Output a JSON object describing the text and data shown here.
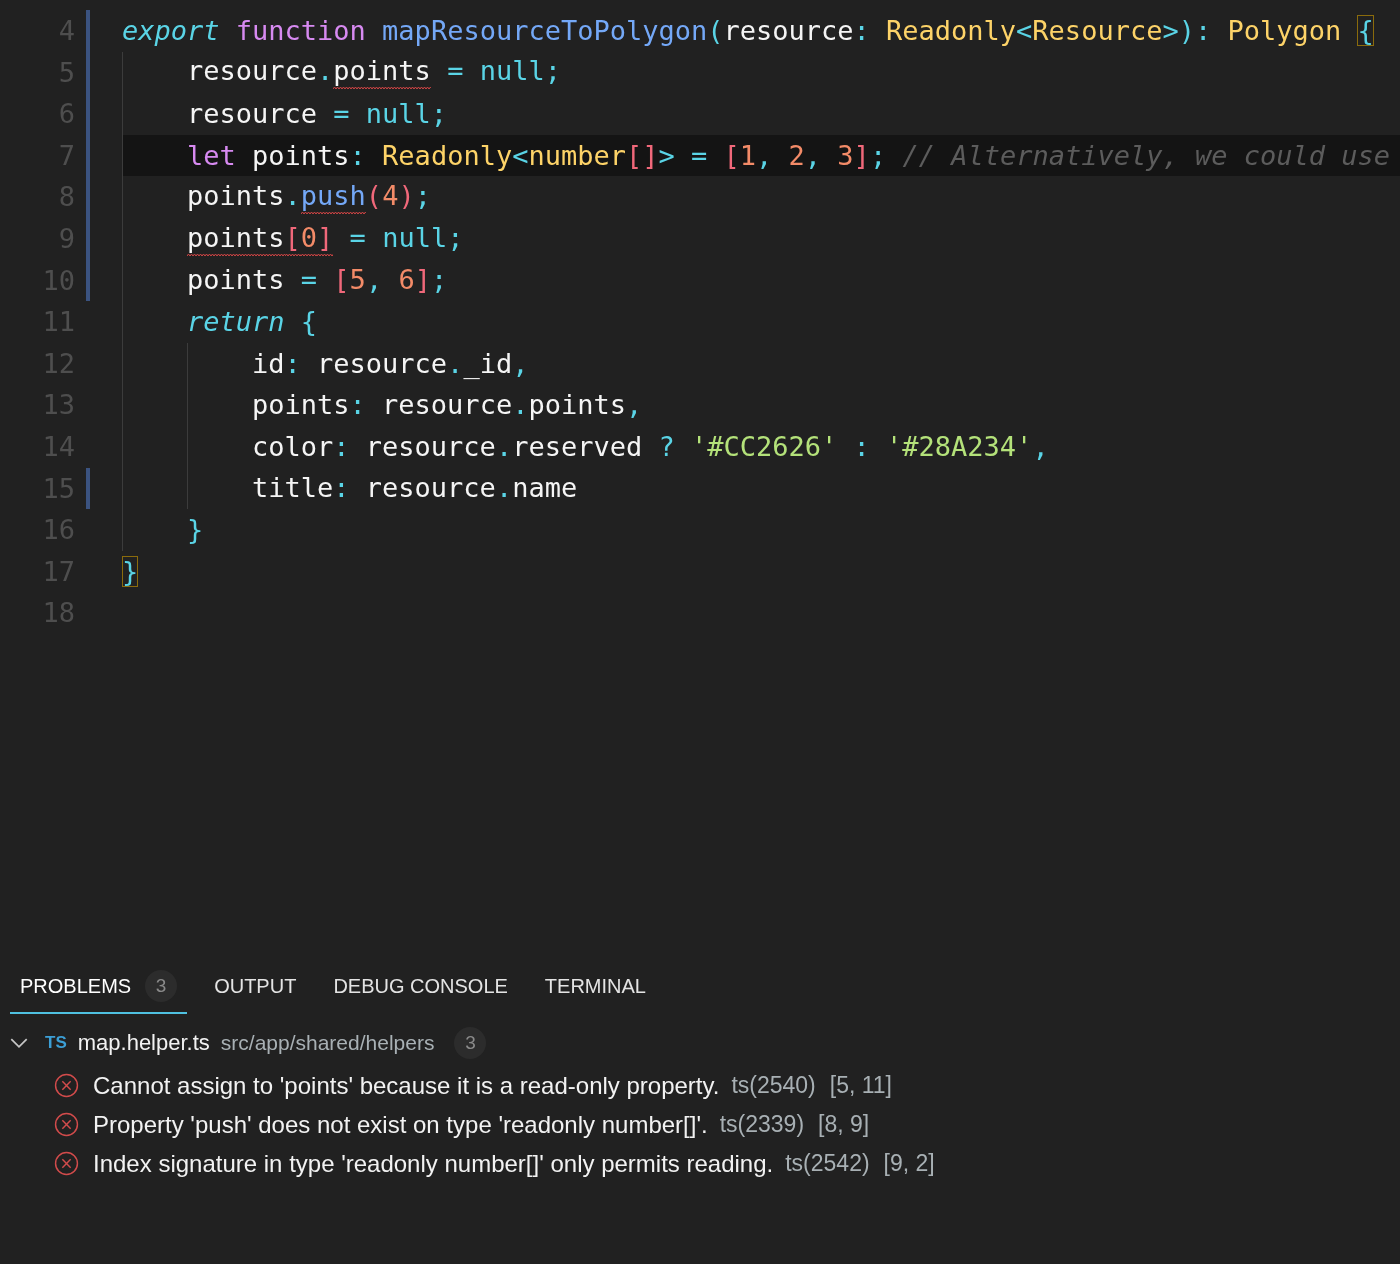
{
  "editor": {
    "lines": [
      {
        "number": "4",
        "modified": true,
        "current": false,
        "tokens": [
          {
            "text": "export ",
            "kind": "keyword"
          },
          {
            "text": "function ",
            "kind": "storage"
          },
          {
            "text": "mapResourceToPolygon",
            "kind": "func"
          },
          {
            "text": "(",
            "kind": "punct"
          },
          {
            "text": "resource",
            "kind": "var"
          },
          {
            "text": ": ",
            "kind": "punct"
          },
          {
            "text": "Readonly",
            "kind": "type"
          },
          {
            "text": "<",
            "kind": "punct"
          },
          {
            "text": "Resource",
            "kind": "type"
          },
          {
            "text": ">): ",
            "kind": "punct"
          },
          {
            "text": "Polygon ",
            "kind": "type"
          },
          {
            "text": "{",
            "kind": "punct",
            "matched": true
          }
        ],
        "children": [
          {
            "number": "5",
            "modified": true,
            "current": false,
            "tokens": [
              {
                "text": "resource",
                "kind": "var"
              },
              {
                "text": ".",
                "kind": "punct"
              },
              {
                "text": "points",
                "kind": "var",
                "error": true
              },
              {
                "text": " = null;",
                "kind": "punct"
              }
            ]
          },
          {
            "number": "6",
            "modified": true,
            "current": false,
            "tokens": [
              {
                "text": "resource",
                "kind": "var"
              },
              {
                "text": " = null;",
                "kind": "punct"
              }
            ]
          },
          {
            "number": "7",
            "modified": true,
            "current": true,
            "tokens": [
              {
                "text": "let ",
                "kind": "storage"
              },
              {
                "text": "points",
                "kind": "var"
              },
              {
                "text": ": ",
                "kind": "punct"
              },
              {
                "text": "Readonly",
                "kind": "type"
              },
              {
                "text": "<",
                "kind": "punct"
              },
              {
                "text": "number",
                "kind": "type"
              },
              {
                "text": "[]",
                "kind": "bracket"
              },
              {
                "text": "> = ",
                "kind": "punct"
              },
              {
                "text": "[",
                "kind": "bracket"
              },
              {
                "text": "1",
                "kind": "number"
              },
              {
                "text": ", ",
                "kind": "punct"
              },
              {
                "text": "2",
                "kind": "number"
              },
              {
                "text": ", ",
                "kind": "punct"
              },
              {
                "text": "3",
                "kind": "number"
              },
              {
                "text": "]",
                "kind": "bracket"
              },
              {
                "text": "; ",
                "kind": "punct"
              },
              {
                "text": "// Alternatively, we could use",
                "kind": "comment"
              }
            ]
          },
          {
            "number": "8",
            "modified": true,
            "current": false,
            "tokens": [
              {
                "text": "points",
                "kind": "var"
              },
              {
                "text": ".",
                "kind": "punct"
              },
              {
                "text": "push",
                "kind": "func",
                "error": true
              },
              {
                "text": "(",
                "kind": "paren"
              },
              {
                "text": "4",
                "kind": "number"
              },
              {
                "text": ")",
                "kind": "paren"
              },
              {
                "text": ";",
                "kind": "punct"
              }
            ]
          },
          {
            "number": "9",
            "modified": true,
            "current": false,
            "tokens": [
              {
                "text": "points",
                "kind": "var",
                "error": true
              },
              {
                "text": "[",
                "kind": "bracket",
                "error": true
              },
              {
                "text": "0",
                "kind": "number",
                "error": true
              },
              {
                "text": "]",
                "kind": "bracket",
                "error": true
              },
              {
                "text": " = null;",
                "kind": "punct"
              }
            ]
          },
          {
            "number": "10",
            "modified": true,
            "current": false,
            "tokens": [
              {
                "text": "points",
                "kind": "var"
              },
              {
                "text": " = ",
                "kind": "punct"
              },
              {
                "text": "[",
                "kind": "bracket"
              },
              {
                "text": "5",
                "kind": "number"
              },
              {
                "text": ", ",
                "kind": "punct"
              },
              {
                "text": "6",
                "kind": "number"
              },
              {
                "text": "]",
                "kind": "bracket"
              },
              {
                "text": ";",
                "kind": "punct"
              }
            ]
          },
          {
            "number": "11",
            "modified": false,
            "current": false,
            "tokens": [
              {
                "text": "return ",
                "kind": "keyword"
              },
              {
                "text": "{",
                "kind": "punct"
              }
            ],
            "children": [
              {
                "number": "12",
                "modified": false,
                "current": false,
                "tokens": [
                  {
                    "text": "id",
                    "kind": "var"
                  },
                  {
                    "text": ": ",
                    "kind": "punct"
                  },
                  {
                    "text": "resource",
                    "kind": "var"
                  },
                  {
                    "text": ".",
                    "kind": "punct"
                  },
                  {
                    "text": "_id",
                    "kind": "var"
                  },
                  {
                    "text": ",",
                    "kind": "punct"
                  }
                ]
              },
              {
                "number": "13",
                "modified": false,
                "current": false,
                "tokens": [
                  {
                    "text": "points",
                    "kind": "var"
                  },
                  {
                    "text": ": ",
                    "kind": "punct"
                  },
                  {
                    "text": "resource",
                    "kind": "var"
                  },
                  {
                    "text": ".",
                    "kind": "punct"
                  },
                  {
                    "text": "points",
                    "kind": "var"
                  },
                  {
                    "text": ",",
                    "kind": "punct"
                  }
                ]
              },
              {
                "number": "14",
                "modified": false,
                "current": false,
                "tokens": [
                  {
                    "text": "color",
                    "kind": "var"
                  },
                  {
                    "text": ": ",
                    "kind": "punct"
                  },
                  {
                    "text": "resource",
                    "kind": "var"
                  },
                  {
                    "text": ".",
                    "kind": "punct"
                  },
                  {
                    "text": "reserved ",
                    "kind": "var"
                  },
                  {
                    "text": "? ",
                    "kind": "punct"
                  },
                  {
                    "text": "'#CC2626'",
                    "kind": "string"
                  },
                  {
                    "text": " : ",
                    "kind": "punct"
                  },
                  {
                    "text": "'#28A234'",
                    "kind": "string"
                  },
                  {
                    "text": ",",
                    "kind": "punct"
                  }
                ]
              },
              {
                "number": "15",
                "modified": true,
                "current": false,
                "tokens": [
                  {
                    "text": "title",
                    "kind": "var"
                  },
                  {
                    "text": ": ",
                    "kind": "punct"
                  },
                  {
                    "text": "resource",
                    "kind": "var"
                  },
                  {
                    "text": ".",
                    "kind": "punct"
                  },
                  {
                    "text": "name",
                    "kind": "var"
                  }
                ]
              }
            ]
          },
          {
            "number": "16",
            "modified": false,
            "current": false,
            "tokens": [
              {
                "text": "}",
                "kind": "punct"
              }
            ]
          }
        ]
      },
      {
        "number": "17",
        "modified": false,
        "current": false,
        "tokens": [
          {
            "text": "}",
            "kind": "punct",
            "matched": true
          }
        ]
      },
      {
        "number": "18",
        "modified": false,
        "current": false
      }
    ]
  },
  "panel": {
    "tabs": [
      {
        "label": "PROBLEMS",
        "selected": true,
        "count": "3"
      },
      {
        "label": "OUTPUT",
        "selected": false
      },
      {
        "label": "DEBUG CONSOLE",
        "selected": false
      },
      {
        "label": "TERMINAL",
        "selected": false
      }
    ],
    "files": [
      {
        "expanded": true,
        "badge": "TS",
        "name": "map.helper.ts",
        "path": "src/app/shared/helpers",
        "count": "3",
        "problems": [
          {
            "kind": "error",
            "message": "Cannot assign to 'points' because it is a read-only property.",
            "code": "ts(2540)",
            "position": "[5, 11]"
          },
          {
            "kind": "error",
            "message": "Property 'push' does not exist on type 'readonly number[]'.",
            "code": "ts(2339)",
            "position": "[8, 9]"
          },
          {
            "kind": "error",
            "message": "Index signature in type 'readonly number[]' only permits reading.",
            "code": "ts(2542)",
            "position": "[9, 2]"
          }
        ]
      }
    ]
  }
}
